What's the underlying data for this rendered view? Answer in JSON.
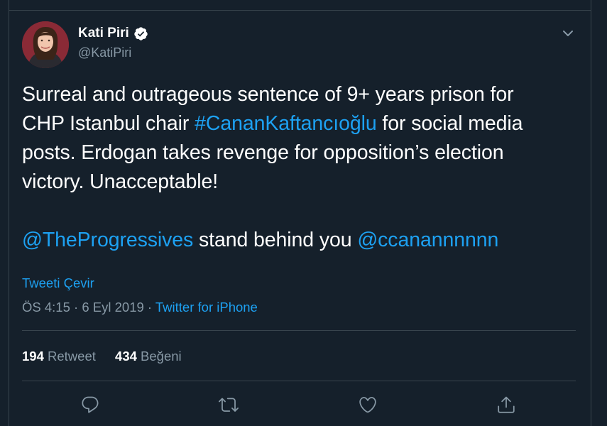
{
  "tweet": {
    "author_name": "Kati Piri",
    "handle": "@KatiPiri",
    "text": {
      "line1": "Surreal and outrageous sentence of 9+ years prison for",
      "line2_prefix": "CHP Istanbul chair ",
      "hashtag": "#CananKaftancıoğlu",
      "line2_suffix": " for social media",
      "line3": "posts. Erdogan takes revenge for opposition’s election",
      "line4": "victory. Unacceptable!",
      "mention1": "@TheProgressives",
      "middle": " stand behind you ",
      "mention2": "@ccanannnnnn"
    },
    "translate_label": "Tweeti Çevir",
    "time": "ÖS 4:15",
    "separator": " · ",
    "date": "6 Eyl 2019",
    "source": "Twitter for iPhone"
  },
  "stats": {
    "retweets_count": "194",
    "retweets_label": " Retweet",
    "likes_count": "434",
    "likes_label": " Beğeni"
  },
  "icons": {
    "verified": "verified-badge-icon",
    "caret": "chevron-down-icon",
    "reply": "reply-icon",
    "retweet": "retweet-icon",
    "like": "heart-icon",
    "share": "share-icon"
  },
  "colors": {
    "background": "#15202b",
    "accent": "#1da1f2",
    "secondary_text": "#8899a6",
    "border": "#38444d"
  }
}
